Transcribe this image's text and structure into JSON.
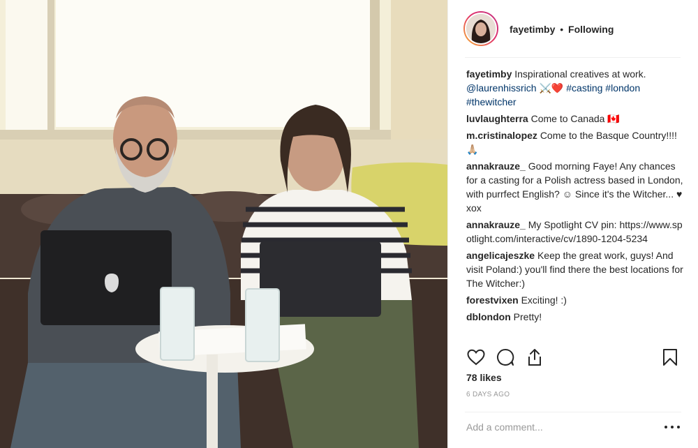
{
  "post": {
    "author": "fayetimby",
    "separator": "•",
    "follow_status": "Following",
    "caption": {
      "author": "fayetimby",
      "text": "Inspirational creatives at work.",
      "mention": "@laurenhissrich",
      "emoji": "⚔️❤️",
      "hashtags": [
        "#casting",
        "#london",
        "#thewitcher"
      ]
    },
    "comments": [
      {
        "author": "luvlaughterra",
        "text": "Come to Canada 🇨🇦"
      },
      {
        "author": "m.cristinalopez",
        "text": "Come to the Basque Country!!!!🙏🏼"
      },
      {
        "author": "annakrauze_",
        "text": "Good morning Faye! Any chances for a casting for a Polish actress based in London, with purrfect English? ☺ Since it's the Witcher... ♥ xox"
      },
      {
        "author": "annakrauze_",
        "text": "My Spotlight CV pin: https://www.spotlight.com/interactive/cv/1890-1204-5234"
      },
      {
        "author": "angelicajeszke",
        "text": "Keep the great work, guys! And visit Poland:) you'll find there the best locations for The Witcher:)"
      },
      {
        "author": "forestvixen",
        "text": "Exciting! :)"
      },
      {
        "author": "dblondon",
        "text": "Pretty!"
      }
    ],
    "likes": "78 likes",
    "time": "6 DAYS AGO",
    "add_comment_placeholder": "Add a comment..."
  },
  "icons": [
    "heart-icon",
    "comment-icon",
    "share-icon",
    "bookmark-icon",
    "more-options-icon"
  ],
  "colors": {
    "hashtag": "#003569",
    "muted": "#999999",
    "text": "#262626"
  }
}
